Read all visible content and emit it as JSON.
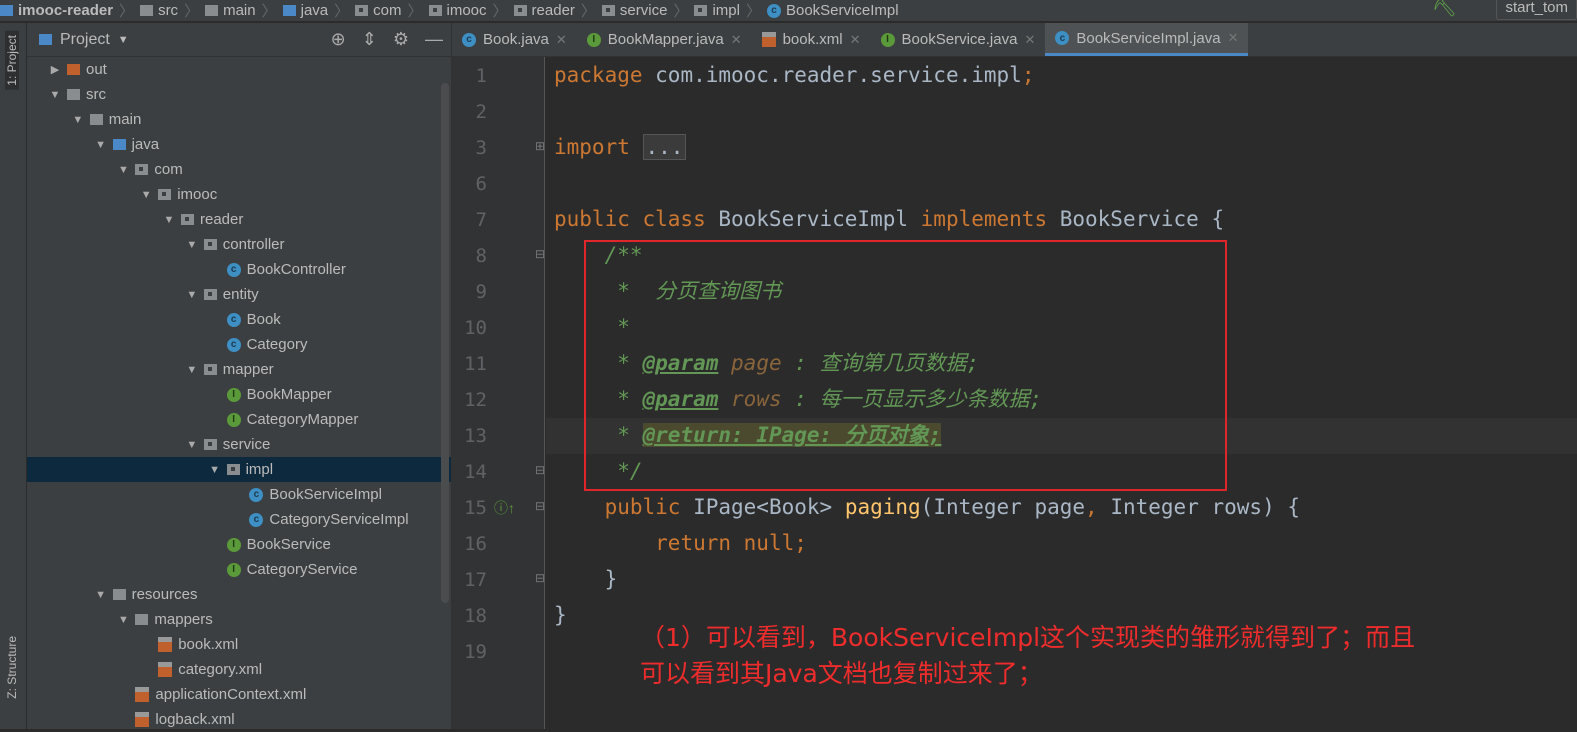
{
  "breadcrumb": [
    "imooc-reader",
    "src",
    "main",
    "java",
    "com",
    "imooc",
    "reader",
    "service",
    "impl",
    "BookServiceImpl"
  ],
  "run_config": "start_tom",
  "side_strip": {
    "project": "1: Project",
    "structure": "Z: Structure"
  },
  "sidebar": {
    "title": "Project",
    "items": [
      {
        "label": "out",
        "level": 0,
        "type": "folder-orange",
        "arrow": "right"
      },
      {
        "label": "src",
        "level": 0,
        "type": "folder",
        "arrow": "down"
      },
      {
        "label": "main",
        "level": 1,
        "type": "folder",
        "arrow": "down"
      },
      {
        "label": "java",
        "level": 2,
        "type": "folder-blue",
        "arrow": "down"
      },
      {
        "label": "com",
        "level": 3,
        "type": "package",
        "arrow": "down"
      },
      {
        "label": "imooc",
        "level": 4,
        "type": "package",
        "arrow": "down"
      },
      {
        "label": "reader",
        "level": 5,
        "type": "package",
        "arrow": "down"
      },
      {
        "label": "controller",
        "level": 6,
        "type": "package",
        "arrow": "down"
      },
      {
        "label": "BookController",
        "level": 7,
        "type": "class"
      },
      {
        "label": "entity",
        "level": 6,
        "type": "package",
        "arrow": "down"
      },
      {
        "label": "Book",
        "level": 7,
        "type": "class"
      },
      {
        "label": "Category",
        "level": 7,
        "type": "class"
      },
      {
        "label": "mapper",
        "level": 6,
        "type": "package",
        "arrow": "down"
      },
      {
        "label": "BookMapper",
        "level": 7,
        "type": "interface"
      },
      {
        "label": "CategoryMapper",
        "level": 7,
        "type": "interface"
      },
      {
        "label": "service",
        "level": 6,
        "type": "package",
        "arrow": "down"
      },
      {
        "label": "impl",
        "level": 7,
        "type": "package",
        "arrow": "down",
        "selected": true
      },
      {
        "label": "BookServiceImpl",
        "level": 8,
        "type": "class"
      },
      {
        "label": "CategoryServiceImpl",
        "level": 8,
        "type": "class"
      },
      {
        "label": "BookService",
        "level": 7,
        "type": "interface"
      },
      {
        "label": "CategoryService",
        "level": 7,
        "type": "interface"
      },
      {
        "label": "resources",
        "level": 2,
        "type": "folder",
        "arrow": "down"
      },
      {
        "label": "mappers",
        "level": 3,
        "type": "folder",
        "arrow": "down"
      },
      {
        "label": "book.xml",
        "level": 4,
        "type": "xml"
      },
      {
        "label": "category.xml",
        "level": 4,
        "type": "xml"
      },
      {
        "label": "applicationContext.xml",
        "level": 3,
        "type": "xml"
      },
      {
        "label": "logback.xml",
        "level": 3,
        "type": "xml"
      }
    ]
  },
  "tabs": [
    {
      "label": "Book.java",
      "type": "class"
    },
    {
      "label": "BookMapper.java",
      "type": "interface"
    },
    {
      "label": "book.xml",
      "type": "xml"
    },
    {
      "label": "BookService.java",
      "type": "interface"
    },
    {
      "label": "BookServiceImpl.java",
      "type": "class",
      "active": true
    }
  ],
  "code_lines": [
    {
      "n": "1",
      "html": "<span class='kw'>package</span> com.imooc.reader.service.impl<span class='kw'>;</span>"
    },
    {
      "n": "2",
      "html": ""
    },
    {
      "n": "3",
      "html": "<span class='kw'>import</span> <span class='fold-box'>...</span>"
    },
    {
      "n": "6",
      "html": ""
    },
    {
      "n": "7",
      "html": "<span class='kw'>public class</span> BookServiceImpl <span class='kw'>implements</span> BookService {"
    },
    {
      "n": "8",
      "html": "    <span class='cm'>/**</span>"
    },
    {
      "n": "9",
      "html": "<span class='cm'>     *  分页查询图书</span>"
    },
    {
      "n": "10",
      "html": "<span class='cm'>     *</span>"
    },
    {
      "n": "11",
      "html": "<span class='cm'>     * </span><span class='tag'>@param</span> <span class='pn'>page</span><span class='cm'> : 查询第几页数据;</span>"
    },
    {
      "n": "12",
      "html": "<span class='cm'>     * </span><span class='tag'>@param</span> <span class='pn'>rows</span><span class='cm'> : 每一页显示多少条数据;</span>"
    },
    {
      "n": "13",
      "html": "<span class='cm'>     * </span><span class='tag' style='background:#4b4a2e'>@return: IPage: 分页对象;</span>"
    },
    {
      "n": "14",
      "html": "<span class='cm'>     */</span>"
    },
    {
      "n": "15",
      "html": "    <span class='kw'>public</span> IPage&lt;Book&gt; <span class='fn'>paging</span>(Integer page<span class='kw'>,</span> Integer rows) {"
    },
    {
      "n": "16",
      "html": "        <span class='kw'>return null;</span>"
    },
    {
      "n": "17",
      "html": "    }"
    },
    {
      "n": "18",
      "html": "}"
    },
    {
      "n": "19",
      "html": ""
    }
  ],
  "annotation": {
    "line1": "（1）可以看到，BookServiceImpl这个实现类的雏形就得到了；而且",
    "line2": "可以看到其Java文档也复制过来了；"
  },
  "colors": {
    "accent": "#4a88c7",
    "highlight_box": "#e0262a",
    "note_text": "#ef2c2c"
  }
}
